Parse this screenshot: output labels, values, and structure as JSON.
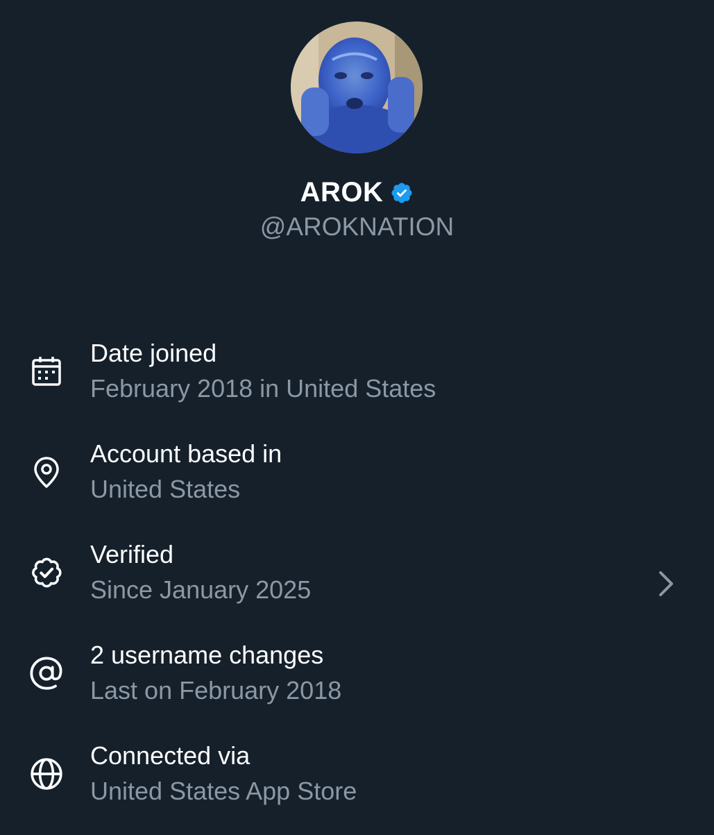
{
  "profile": {
    "display_name": "AROK",
    "handle": "@AROKNATION",
    "verified_badge_color": "#1d9bf0"
  },
  "rows": [
    {
      "icon": "calendar-icon",
      "title": "Date joined",
      "subtitle": "February 2018 in United States"
    },
    {
      "icon": "location-pin-icon",
      "title": "Account based in",
      "subtitle": "United States"
    },
    {
      "icon": "verified-badge-icon",
      "title": "Verified",
      "subtitle": "Since January 2025",
      "has_chevron": true
    },
    {
      "icon": "at-sign-icon",
      "title": "2 username changes",
      "subtitle": "Last on February 2018"
    },
    {
      "icon": "globe-icon",
      "title": "Connected via",
      "subtitle": "United States App Store"
    }
  ],
  "colors": {
    "background": "#15202b",
    "primary_text": "#ffffff",
    "secondary_text": "#8b98a5"
  }
}
